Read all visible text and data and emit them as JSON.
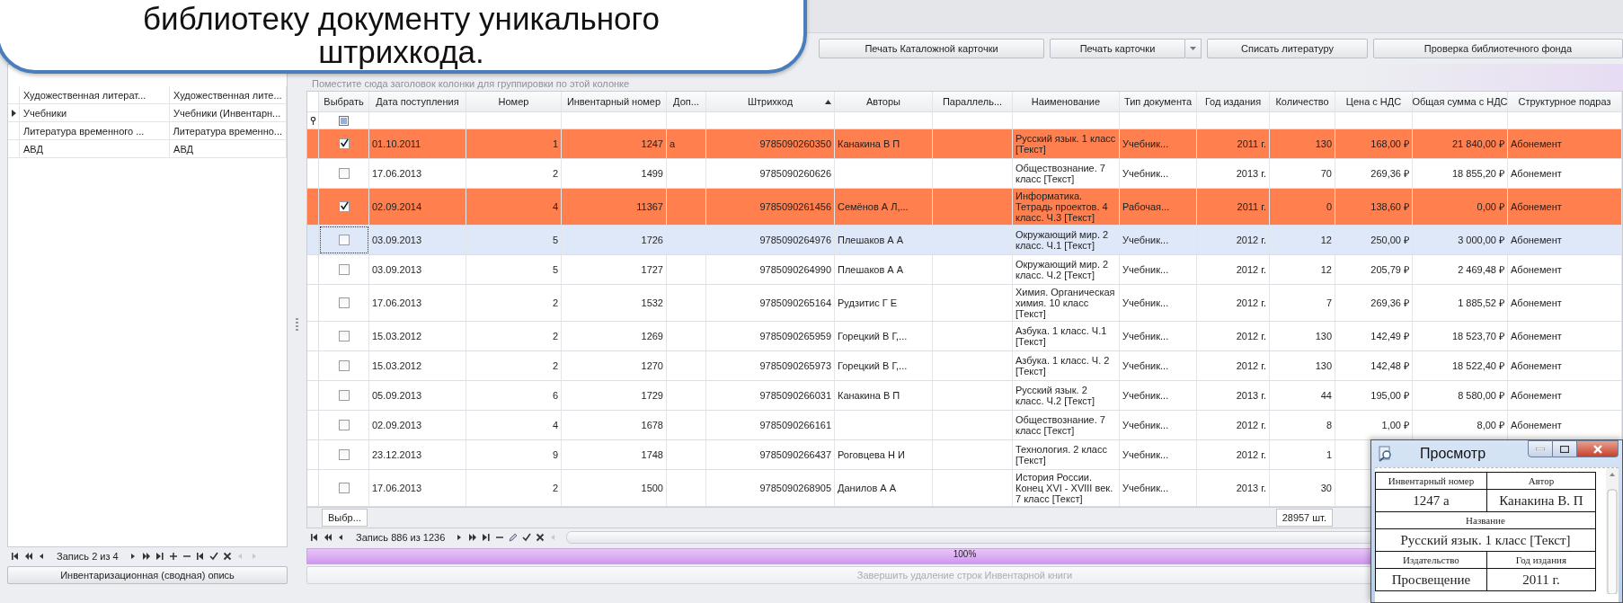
{
  "callout": {
    "lines": [
      "библиотеку документу уникального",
      "штрихкода."
    ]
  },
  "toolbar": {
    "buttons": [
      {
        "label": "Печать Каталожной карточки",
        "kind": "plain"
      },
      {
        "label": "Печать карточки",
        "kind": "split"
      },
      {
        "label": "Списать литературу",
        "kind": "plain"
      },
      {
        "label": "Проверка библиотечного фонда",
        "kind": "plain"
      }
    ]
  },
  "left_panel": {
    "rows": [
      {
        "cells": [
          "Художественная литерат...",
          "Художественная лите..."
        ],
        "selected": false
      },
      {
        "cells": [
          "Учебники",
          "Учебники (Инвентарн..."
        ],
        "selected": true
      },
      {
        "cells": [
          "Литература временного ...",
          "Литература временно..."
        ],
        "selected": false
      },
      {
        "cells": [
          "АВД",
          "АВД"
        ],
        "selected": false
      }
    ],
    "navigator": {
      "record": "Запись 2 из 4"
    },
    "button": {
      "label": "Инвентаризационная (сводная) опись"
    }
  },
  "grid": {
    "group_panel": "Поместите сюда заголовок колонки для группировки по этой колонке",
    "columns": [
      {
        "label": "Выбрать",
        "sorted": false
      },
      {
        "label": "Дата поступления",
        "sorted": false
      },
      {
        "label": "Номер",
        "sorted": false
      },
      {
        "label": "Инвентарный номер",
        "sorted": false
      },
      {
        "label": "Доп...",
        "sorted": false
      },
      {
        "label": "Штрихкод",
        "sorted": true
      },
      {
        "label": "Авторы",
        "sorted": false
      },
      {
        "label": "Параллель...",
        "sorted": false
      },
      {
        "label": "Наименование",
        "sorted": false
      },
      {
        "label": "Тип документа",
        "sorted": false
      },
      {
        "label": "Год издания",
        "sorted": false
      },
      {
        "label": "Количество",
        "sorted": false
      },
      {
        "label": "Цена с НДС",
        "sorted": false
      },
      {
        "label": "Общая сумма с НДС",
        "sorted": false
      },
      {
        "label": "Структурное подраз",
        "sorted": false
      }
    ],
    "select_all": {
      "indeterminate": true
    },
    "rows": [
      {
        "checked": true,
        "selected": false,
        "cells": [
          "",
          "01.10.2011",
          "1",
          "1247",
          "а",
          "9785090260350",
          "Канакина В П",
          null,
          "Русский язык. 1 класс [Текст]",
          "Учебник...",
          "2011 г.",
          "130",
          "168,00 ₽",
          "21 840,00 ₽",
          "Абонемент"
        ]
      },
      {
        "checked": false,
        "selected": false,
        "cells": [
          "",
          "17.06.2013",
          "2",
          "1499",
          null,
          "9785090260626",
          null,
          null,
          "Обществознание. 7 класс [Текст]",
          "Учебник...",
          "2013 г.",
          "70",
          "269,36 ₽",
          "18 855,20 ₽",
          "Абонемент"
        ]
      },
      {
        "checked": true,
        "selected": false,
        "cells": [
          "",
          "02.09.2014",
          "4",
          "11367",
          null,
          "9785090261456",
          "Семёнов А Л,...",
          null,
          "Информатика. Тетрадь проектов. 4 класс. Ч.3 [Текст]",
          "Рабочая...",
          "2011 г.",
          "0",
          "138,60 ₽",
          "0,00 ₽",
          "Абонемент"
        ]
      },
      {
        "checked": false,
        "selected": true,
        "cells": [
          "",
          "03.09.2013",
          "5",
          "1726",
          null,
          "9785090264976",
          "Плешаков А А",
          null,
          "Окружающий мир. 2 класс. Ч.1  [Текст]",
          "Учебник...",
          "2012 г.",
          "12",
          "250,00 ₽",
          "3 000,00 ₽",
          "Абонемент"
        ]
      },
      {
        "checked": false,
        "selected": false,
        "cells": [
          "",
          "03.09.2013",
          "5",
          "1727",
          null,
          "9785090264990",
          "Плешаков А А",
          null,
          "Окружающий мир. 2 класс. Ч.2  [Текст]",
          "Учебник...",
          "2012 г.",
          "12",
          "205,79 ₽",
          "2 469,48 ₽",
          "Абонемент"
        ]
      },
      {
        "checked": false,
        "selected": false,
        "cells": [
          "",
          "17.06.2013",
          "2",
          "1532",
          null,
          "9785090265164",
          "Рудзитис Г Е",
          null,
          "Химия. Органическая химия. 10 класс [Текст]",
          "Учебник...",
          "2012 г.",
          "7",
          "269,36 ₽",
          "1 885,52 ₽",
          "Абонемент"
        ]
      },
      {
        "checked": false,
        "selected": false,
        "cells": [
          "",
          "15.03.2012",
          "2",
          "1269",
          null,
          "9785090265959",
          "Горецкий В Г,...",
          null,
          "Азбука. 1 класс.  Ч.1 [Текст]",
          "Учебник...",
          "2012 г.",
          "130",
          "142,49 ₽",
          "18 523,70 ₽",
          "Абонемент"
        ]
      },
      {
        "checked": false,
        "selected": false,
        "cells": [
          "",
          "15.03.2012",
          "2",
          "1270",
          null,
          "9785090265973",
          "Горецкий В Г,...",
          null,
          "Азбука. 1 класс. Ч. 2 [Текст]",
          "Учебник...",
          "2012 г.",
          "130",
          "142,48 ₽",
          "18 522,40 ₽",
          "Абонемент"
        ]
      },
      {
        "checked": false,
        "selected": false,
        "cells": [
          "",
          "05.09.2013",
          "6",
          "1729",
          null,
          "9785090266031",
          "Канакина В П",
          null,
          "Русский язык. 2 класс. Ч.2  [Текст]",
          "Учебник...",
          "2013 г.",
          "44",
          "195,00 ₽",
          "8 580,00 ₽",
          "Абонемент"
        ]
      },
      {
        "checked": false,
        "selected": false,
        "cells": [
          "",
          "02.09.2013",
          "4",
          "1678",
          null,
          "9785090266161",
          null,
          null,
          "Обществознание. 7 класс [Текст]",
          "Учебник...",
          "2012 г.",
          "8",
          "1,00 ₽",
          "8,00 ₽",
          "Абонемент"
        ]
      },
      {
        "checked": false,
        "selected": false,
        "cells": [
          "",
          "23.12.2013",
          "9",
          "1748",
          null,
          "9785090266437",
          "Роговцева Н И",
          null,
          "Технология. 2 класс [Текст]",
          "Учебник...",
          "2012 г.",
          "1",
          null,
          null,
          null
        ]
      },
      {
        "checked": false,
        "selected": false,
        "cells": [
          "",
          "17.06.2013",
          "2",
          "1500",
          null,
          "9785090268905",
          "Данилов А А",
          null,
          "История России. Конец XVI - XVIII век. 7 класс [Текст]",
          "Учебник...",
          "2013 г.",
          "30",
          null,
          null,
          null
        ]
      }
    ],
    "footer": {
      "select_button": "Выбр...",
      "count": "28957 шт."
    },
    "navigator": {
      "record": "Запись 886 из 1236"
    }
  },
  "progress": {
    "level": 1,
    "text": "100%"
  },
  "finish_button": {
    "label": "Завершить удаление строк Инвентарной книги",
    "disabled": true
  },
  "preview": {
    "title": "Просмотр",
    "card_rows": [
      {
        "kind": "label",
        "cells": [
          "Инвентарный номер",
          "Автор"
        ]
      },
      {
        "kind": "value",
        "cells": [
          "1247 а",
          "Канакина В. П"
        ]
      },
      {
        "kind": "label",
        "cells": [
          "Название"
        ]
      },
      {
        "kind": "value",
        "cells": [
          "Русский язык. 1 класс  [Текст]"
        ]
      },
      {
        "kind": "label",
        "cells": [
          "Издательство",
          "Год издания"
        ]
      },
      {
        "kind": "value",
        "cells": [
          "Просвещение",
          "2011 г."
        ]
      }
    ]
  }
}
